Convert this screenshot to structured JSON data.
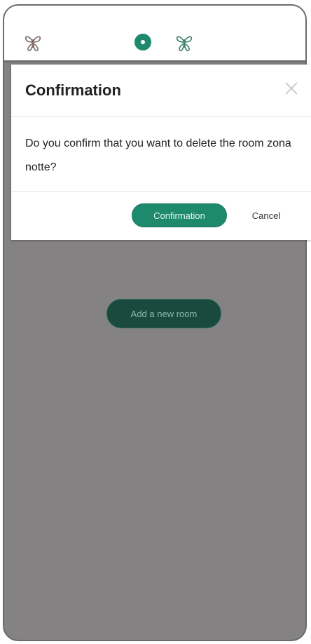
{
  "header": {
    "left_icon": "butterfly-logo-icon",
    "center_badge_icon": "active-dot-icon",
    "right_icon": "butterfly-logo-icon"
  },
  "background": {
    "add_room_label": "Add a new room"
  },
  "dialog": {
    "title": "Confirmation",
    "close_icon": "close-icon",
    "message": "Do you confirm that you want to delete the room zona notte?",
    "confirm_label": "Confirmation",
    "cancel_label": "Cancel"
  },
  "colors": {
    "accent": "#1d8a6e",
    "overlay": "#848283",
    "dark_button": "#1a4a3d"
  }
}
